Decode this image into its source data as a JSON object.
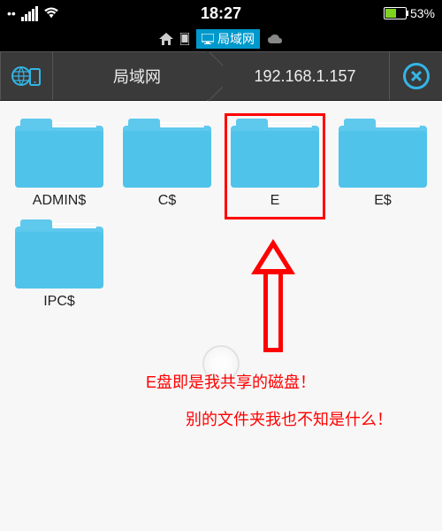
{
  "status": {
    "time": "18:27",
    "battery_pct": "53%"
  },
  "breadcrumb": {
    "active_label": "局域网"
  },
  "nav": {
    "location_label": "局域网",
    "ip": "192.168.1.157"
  },
  "folders": [
    {
      "label": "ADMIN$"
    },
    {
      "label": "C$"
    },
    {
      "label": "E",
      "highlighted": true
    },
    {
      "label": "E$"
    },
    {
      "label": "IPC$"
    }
  ],
  "annotations": {
    "line1": "E盘即是我共享的磁盘！",
    "line2": "别的文件夹我也不知是什么！"
  }
}
